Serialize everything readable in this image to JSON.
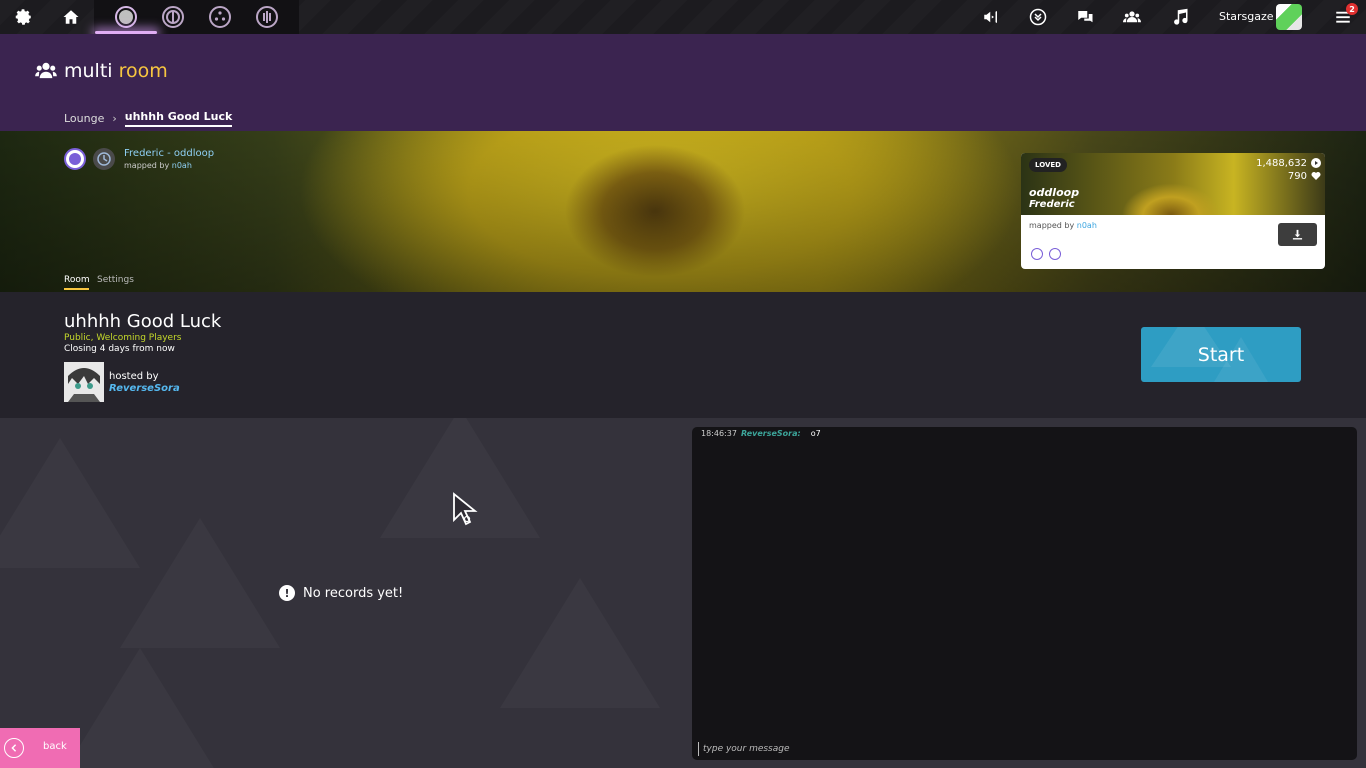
{
  "toolbar": {
    "username": "Starsgaze",
    "notification_count": "2",
    "icons": [
      "settings-icon",
      "home-icon",
      "ruleset-osu-icon",
      "ruleset-taiko-icon",
      "ruleset-catch-icon",
      "ruleset-mania-icon",
      "news-icon",
      "beatmap-listing-icon",
      "chat-icon",
      "social-icon",
      "music-icon",
      "menu-icon"
    ]
  },
  "header": {
    "title_main": "multi ",
    "title_accent": "room",
    "breadcrumb": {
      "parent": "Lounge",
      "current": "uhhhh Good Luck"
    }
  },
  "banner": {
    "song": "Frederic - oddloop",
    "mapped_by_label": "mapped by ",
    "mapper": "n0ah",
    "tabs": [
      "Room",
      "Settings"
    ]
  },
  "beatmap_card": {
    "status": "LOVED",
    "plays": "1,488,632",
    "favourites": "790",
    "title": "oddloop",
    "artist": "Frederic",
    "mapped_by_label": "mapped by ",
    "mapper": "n0ah"
  },
  "room": {
    "name": "uhhhh Good Luck",
    "type": "Public, Welcoming Players",
    "closing": "Closing 4 days from now",
    "hosted_by_label": "hosted by",
    "host": "ReverseSora",
    "start_label": "Start"
  },
  "leaderboard": {
    "empty_text": "No records yet!"
  },
  "chat": {
    "messages": [
      {
        "time": "18:46:37",
        "user": "ReverseSora:",
        "text": "o7"
      }
    ],
    "input_placeholder": "type your message"
  },
  "footer": {
    "back_label": "back"
  },
  "colors": {
    "accent_yellow": "#f7c640",
    "header_purple": "#3b2450",
    "start_blue": "#2e9dc3",
    "back_pink": "#f06cb3",
    "link_blue": "#55b8ef"
  }
}
